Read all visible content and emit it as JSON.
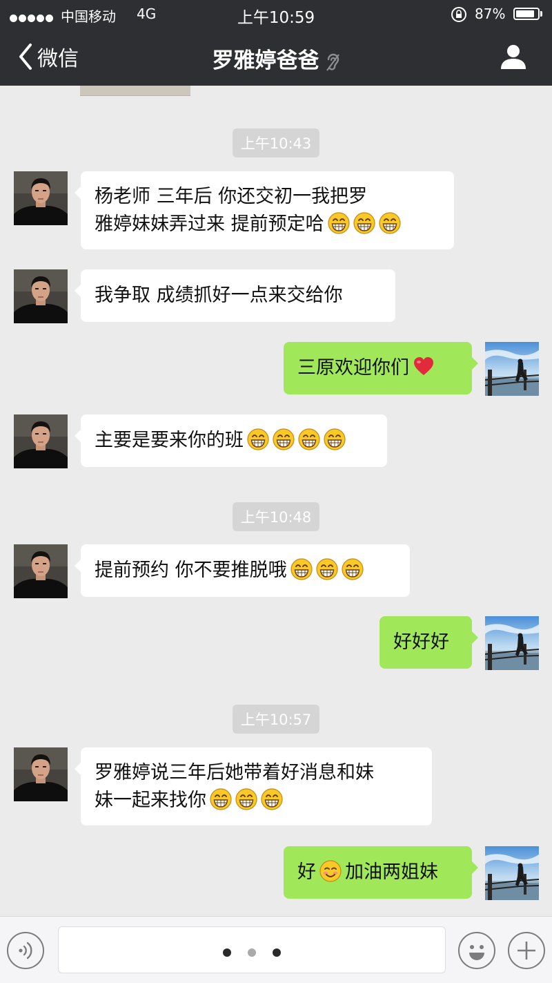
{
  "status_bar": {
    "carrier": "中国移动",
    "network": "4G",
    "time": "上午10:59",
    "battery_percent": "87%",
    "battery_level": 0.87
  },
  "nav": {
    "back_label": "微信",
    "title": "罗雅婷爸爸",
    "icons": [
      "chevron-left-icon",
      "ear-mute-icon",
      "person-icon"
    ]
  },
  "chat": {
    "timestamps": [
      "上午10:43",
      "上午10:48",
      "上午10:57"
    ],
    "messages": [
      {
        "from": "other",
        "lines": [
          "杨老师 三年后 你还交初一我把罗",
          "雅婷妹妹弄过来 提前预定哈"
        ],
        "emoji": [
          "grin",
          "grin",
          "grin"
        ]
      },
      {
        "from": "other",
        "lines": [
          "我争取 成绩抓好一点来交给你"
        ],
        "emoji": []
      },
      {
        "from": "me",
        "lines": [
          "三原欢迎你们"
        ],
        "emoji": [
          "red-heart"
        ]
      },
      {
        "from": "other",
        "lines": [
          "主要是要来你的班"
        ],
        "emoji": [
          "grin",
          "grin",
          "grin",
          "grin"
        ]
      },
      {
        "from": "other",
        "lines": [
          "提前预约 你不要推脱哦"
        ],
        "emoji": [
          "grin",
          "grin",
          "grin"
        ]
      },
      {
        "from": "me",
        "lines": [
          "好好好"
        ],
        "emoji": []
      },
      {
        "from": "other",
        "lines": [
          "罗雅婷说三年后她带着好消息和妹",
          "妹一起来找你"
        ],
        "emoji": [
          "grin",
          "grin",
          "grin"
        ]
      },
      {
        "from": "me",
        "parts": [
          "好",
          "加油两姐妹"
        ],
        "emoji": [
          "smile"
        ]
      }
    ]
  },
  "input_bar": {
    "icons": [
      "voice-icon",
      "emoji-icon",
      "plus-icon"
    ],
    "page_dots": 3,
    "active_dot": 1
  },
  "colors": {
    "header_bg": "#2e2f33",
    "chat_bg": "#ebebeb",
    "incoming_bubble": "#ffffff",
    "outgoing_bubble": "#a0e75a",
    "timestamp_bg": "#d5d5d5"
  }
}
